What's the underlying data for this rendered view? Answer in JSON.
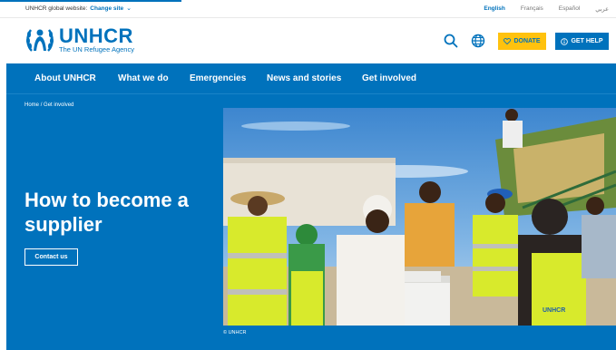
{
  "topbar": {
    "global_label": "UNHCR global website:",
    "change_site": "Change site",
    "languages": [
      {
        "label": "English",
        "active": true
      },
      {
        "label": "Français",
        "active": false
      },
      {
        "label": "Español",
        "active": false
      },
      {
        "label": "عربي",
        "active": false
      }
    ]
  },
  "header": {
    "logo_main": "UNHCR",
    "logo_sub": "The UN Refugee Agency",
    "donate_label": "DONATE",
    "help_label": "GET HELP",
    "icons": [
      "search-icon",
      "globe-icon",
      "heart-icon",
      "info-icon",
      "laurel-logo-icon"
    ]
  },
  "nav": {
    "items": [
      "About UNHCR",
      "What we do",
      "Emergencies",
      "News and stories",
      "Get involved"
    ]
  },
  "breadcrumb": {
    "home": "Home",
    "separator": "/",
    "current": "Get involved"
  },
  "hero": {
    "title": "How to become a supplier",
    "cta_label": "Contact us",
    "photo_credit": "© UNHCR",
    "vest_label": "UNHCR"
  },
  "colors": {
    "brand_blue": "#0072bc",
    "donate_yellow": "#ffc20e",
    "white": "#ffffff"
  }
}
